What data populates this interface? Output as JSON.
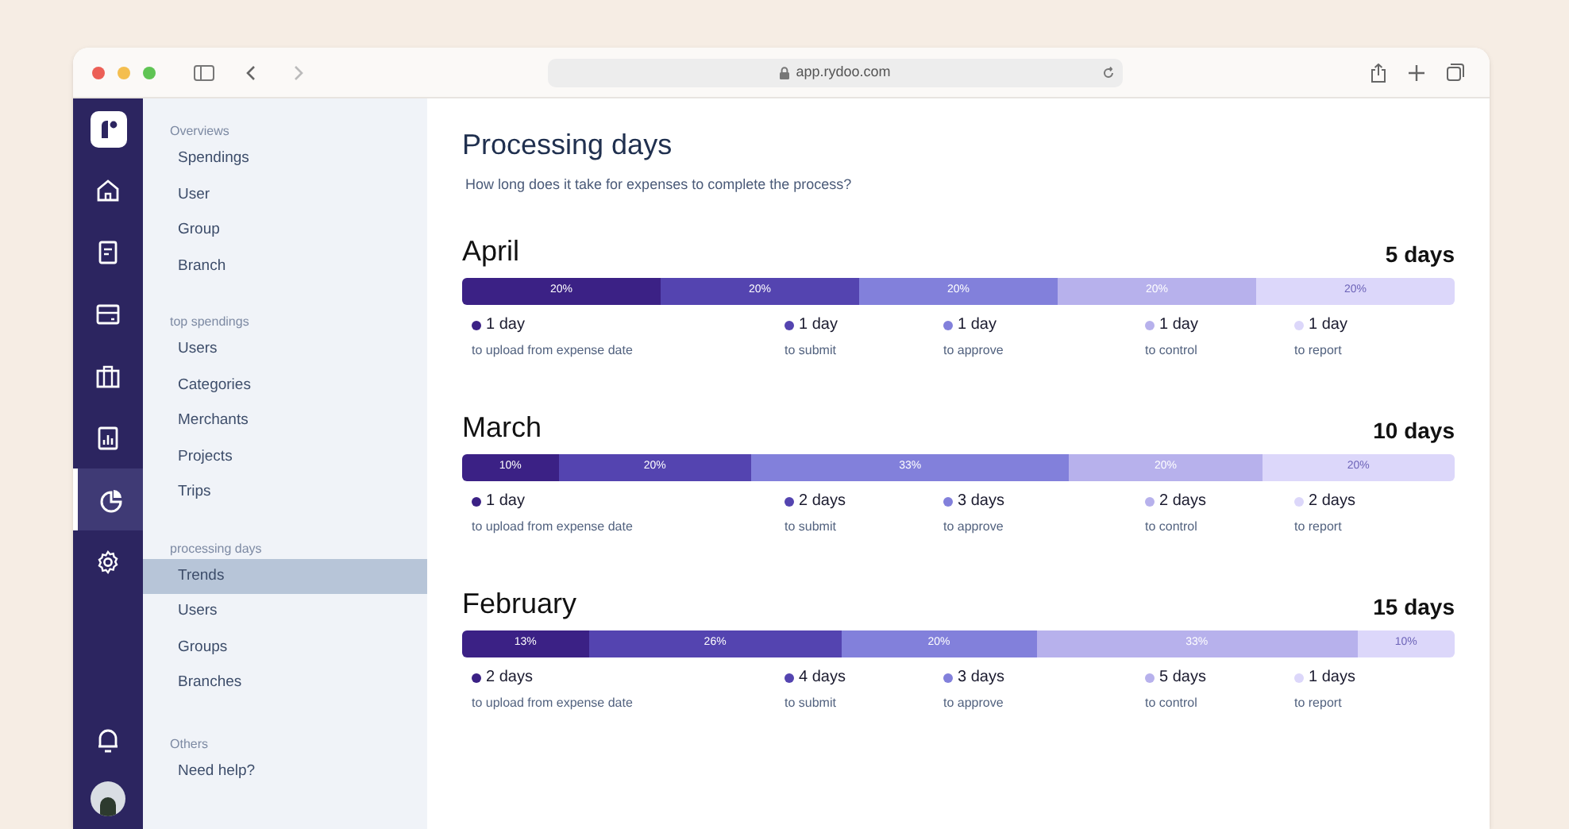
{
  "browser": {
    "url": "app.rydoo.com"
  },
  "rail": [
    {
      "selected": false
    },
    {
      "selected": false
    },
    {
      "selected": false
    },
    {
      "selected": false
    },
    {
      "selected": false
    },
    {
      "selected": true
    },
    {
      "selected": false
    }
  ],
  "sidebar": [
    {
      "heading": "Overviews",
      "items": [
        {
          "label": "Spendings",
          "selected": false
        },
        {
          "label": "User",
          "selected": false
        },
        {
          "label": "Group",
          "selected": false
        },
        {
          "label": "Branch",
          "selected": false
        }
      ]
    },
    {
      "heading": "top spendings",
      "items": [
        {
          "label": "Users",
          "selected": false
        },
        {
          "label": "Categories",
          "selected": false
        },
        {
          "label": "Merchants",
          "selected": false
        },
        {
          "label": "Projects",
          "selected": false
        },
        {
          "label": "Trips",
          "selected": false
        }
      ]
    },
    {
      "heading": "processing days",
      "items": [
        {
          "label": "Trends",
          "selected": true
        },
        {
          "label": "Users",
          "selected": false
        },
        {
          "label": "Groups",
          "selected": false
        },
        {
          "label": "Branches",
          "selected": false
        }
      ]
    },
    {
      "heading": "Others",
      "items": [
        {
          "label": "Need help?",
          "selected": false
        }
      ]
    }
  ],
  "page": {
    "title": "Processing days",
    "subtitle": "How long does it take for expenses to complete the process?"
  },
  "months": [
    {
      "name": "April",
      "total": "5 days",
      "segments": [
        {
          "label": "20%"
        },
        {
          "label": "20%"
        },
        {
          "label": "20%"
        },
        {
          "label": "20%"
        },
        {
          "label": "20%"
        }
      ],
      "steps": [
        {
          "value": "1 day",
          "caption": "to upload from expense date"
        },
        {
          "value": "1 day",
          "caption": "to submit"
        },
        {
          "value": "1 day",
          "caption": "to approve"
        },
        {
          "value": "1 day",
          "caption": "to control"
        },
        {
          "value": "1 day",
          "caption": "to report"
        }
      ]
    },
    {
      "name": "March",
      "total": "10 days",
      "segments": [
        {
          "label": "10%"
        },
        {
          "label": "20%"
        },
        {
          "label": "33%"
        },
        {
          "label": "20%"
        },
        {
          "label": "20%"
        }
      ],
      "steps": [
        {
          "value": "1 day",
          "caption": "to upload from expense date"
        },
        {
          "value": "2 days",
          "caption": "to submit"
        },
        {
          "value": "3 days",
          "caption": "to approve"
        },
        {
          "value": "2 days",
          "caption": "to control"
        },
        {
          "value": "2 days",
          "caption": "to report"
        }
      ]
    },
    {
      "name": "February",
      "total": "15 days",
      "segments": [
        {
          "label": "13%"
        },
        {
          "label": "26%"
        },
        {
          "label": "20%"
        },
        {
          "label": "33%"
        },
        {
          "label": "10%"
        }
      ],
      "steps": [
        {
          "value": "2 days",
          "caption": "to upload from expense date"
        },
        {
          "value": "4 days",
          "caption": "to submit"
        },
        {
          "value": "3 days",
          "caption": "to approve"
        },
        {
          "value": "5 days",
          "caption": "to control"
        },
        {
          "value": "1 days",
          "caption": "to report"
        }
      ]
    }
  ]
}
